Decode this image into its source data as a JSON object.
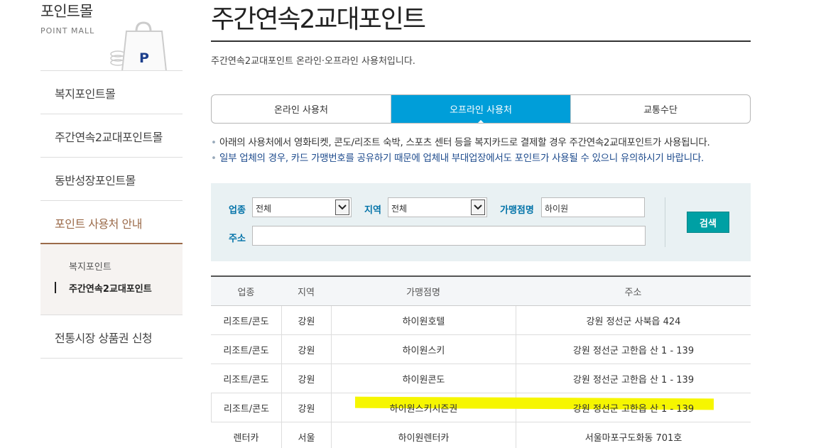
{
  "sidebar": {
    "title": "포인트몰",
    "subtitle": "POINT MALL",
    "bag_icon_letter": "P",
    "items": [
      {
        "label": "복지포인트몰"
      },
      {
        "label": "주간연속2교대포인트몰"
      },
      {
        "label": "동반성장포인트몰"
      },
      {
        "label": "포인트 사용처 안내"
      },
      {
        "label": "전통시장 상품권 신청"
      }
    ],
    "sub_items": [
      {
        "label": "복지포인트"
      },
      {
        "label": "주간연속2교대포인트"
      }
    ],
    "accent_color": "#9b6b4a"
  },
  "main": {
    "title": "주간연속2교대포인트",
    "description": "주간연속2교대포인트 온라인·오프라인 사용처입니다.",
    "tabs": [
      {
        "label": "온라인 사용처"
      },
      {
        "label": "오프라인 사용처"
      },
      {
        "label": "교통수단"
      }
    ],
    "tab_active_color": "#009ed9",
    "notes": [
      "아래의 사용처에서 영화티켓, 콘도/리조트 숙박, 스포츠 센터 등을 복지카드로 결제할 경우 주간연속2교대포인트가 사용됩니다.",
      "일부 업체의 경우, 카드 가맹번호를 공유하기 때문에 업체내 부대업장에서도 포인트가 사용될 수 있으니 유의하시기 바랍니다."
    ],
    "search": {
      "category_label": "업종",
      "category_value": "전체",
      "region_label": "지역",
      "region_value": "전체",
      "store_label": "가맹점명",
      "store_value": "하이원",
      "address_label": "주소",
      "address_value": "",
      "button_label": "검색"
    },
    "table": {
      "headers": [
        "업종",
        "지역",
        "가맹점명",
        "주소"
      ],
      "rows": [
        [
          "리조트/콘도",
          "강원",
          "하이원호텔",
          "강원 정선군 사북읍 424"
        ],
        [
          "리조트/콘도",
          "강원",
          "하이원스키",
          "강원 정선군 고한읍 산 1 - 139"
        ],
        [
          "리조트/콘도",
          "강원",
          "하이원콘도",
          "강원 정선군 고한읍 산 1 - 139"
        ],
        [
          "리조트/콘도",
          "강원",
          "하이원스키시즌권",
          "강원 정선군 고한읍 산 1 - 139"
        ],
        [
          "렌터카",
          "서울",
          "하이원렌터카",
          "서울마포구도화동 701호"
        ]
      ],
      "highlight_color": "#f6f600"
    }
  }
}
